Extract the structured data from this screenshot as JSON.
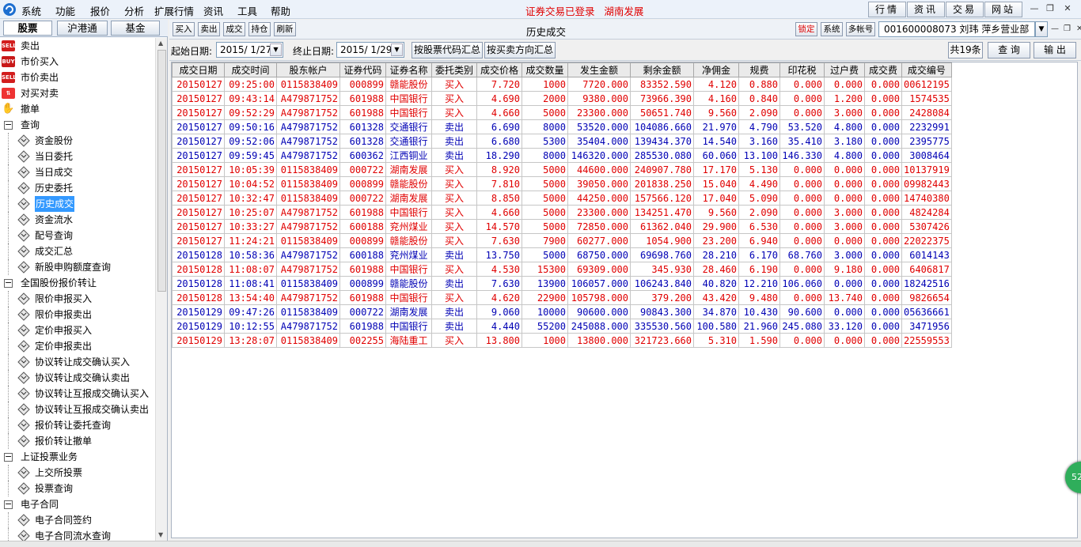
{
  "menubar": {
    "items": [
      "系统",
      "功能",
      "报价",
      "分析",
      "扩展行情",
      "资讯",
      "工具",
      "帮助"
    ],
    "status": "证券交易已登录   湖南发展",
    "right_buttons": [
      "行情",
      "资讯",
      "交易",
      "网站"
    ]
  },
  "sidebar": {
    "tabs": [
      "股票",
      "沪港通",
      "基金"
    ],
    "tree": [
      {
        "label": "卖出",
        "icon": "sell-icon",
        "icon_text": "SELL",
        "level": 0
      },
      {
        "label": "市价买入",
        "icon": "buy-icon",
        "icon_text": "BUY",
        "level": 0
      },
      {
        "label": "市价卖出",
        "icon": "sell-icon",
        "icon_text": "SELL",
        "level": 0
      },
      {
        "label": "对买对卖",
        "icon": "swap-icon",
        "icon_text": "⇅",
        "level": 0
      },
      {
        "label": "撤单",
        "icon": "cancel-icon",
        "icon_text": "✋",
        "level": 0
      },
      {
        "label": "查询",
        "icon": "collapse-icon",
        "level": 0
      },
      {
        "label": "资金股份",
        "icon": "diamond-icon",
        "level": 1
      },
      {
        "label": "当日委托",
        "icon": "diamond-icon",
        "level": 1
      },
      {
        "label": "当日成交",
        "icon": "diamond-icon",
        "level": 1
      },
      {
        "label": "历史委托",
        "icon": "diamond-icon",
        "level": 1
      },
      {
        "label": "历史成交",
        "icon": "diamond-icon",
        "level": 1,
        "selected": true
      },
      {
        "label": "资金流水",
        "icon": "diamond-icon",
        "level": 1
      },
      {
        "label": "配号查询",
        "icon": "diamond-icon",
        "level": 1
      },
      {
        "label": "成交汇总",
        "icon": "diamond-icon",
        "level": 1
      },
      {
        "label": "新股申购额度查询",
        "icon": "diamond-icon",
        "level": 1
      },
      {
        "label": "全国股份报价转让",
        "icon": "collapse-icon",
        "level": 0
      },
      {
        "label": "限价申报买入",
        "icon": "diamond-icon",
        "level": 1
      },
      {
        "label": "限价申报卖出",
        "icon": "diamond-icon",
        "level": 1
      },
      {
        "label": "定价申报买入",
        "icon": "diamond-icon",
        "level": 1
      },
      {
        "label": "定价申报卖出",
        "icon": "diamond-icon",
        "level": 1
      },
      {
        "label": "协议转让成交确认买入",
        "icon": "diamond-icon",
        "level": 1
      },
      {
        "label": "协议转让成交确认卖出",
        "icon": "diamond-icon",
        "level": 1
      },
      {
        "label": "协议转让互报成交确认买入",
        "icon": "diamond-icon",
        "level": 1
      },
      {
        "label": "协议转让互报成交确认卖出",
        "icon": "diamond-icon",
        "level": 1
      },
      {
        "label": "报价转让委托查询",
        "icon": "diamond-icon",
        "level": 1
      },
      {
        "label": "报价转让撤单",
        "icon": "diamond-icon",
        "level": 1
      },
      {
        "label": "上证投票业务",
        "icon": "collapse-icon",
        "level": 0
      },
      {
        "label": "上交所投票",
        "icon": "diamond-icon",
        "level": 1
      },
      {
        "label": "投票查询",
        "icon": "diamond-icon",
        "level": 1
      },
      {
        "label": "电子合同",
        "icon": "collapse-icon",
        "level": 0
      },
      {
        "label": "电子合同签约",
        "icon": "diamond-icon",
        "level": 1
      },
      {
        "label": "电子合同流水查询",
        "icon": "diamond-icon",
        "level": 1
      }
    ]
  },
  "toolbar": {
    "buttons": [
      "买入",
      "卖出",
      "成交",
      "持仓",
      "刷新"
    ],
    "title": "历史成交",
    "right_buttons": [
      "锁定",
      "系统",
      "多帐号"
    ],
    "account": "001600008073  刘玮  萍乡营业部"
  },
  "filter": {
    "start_label": "起始日期:",
    "start_value": "2015/ 1/27",
    "end_label": "终止日期:",
    "end_value": "2015/ 1/29",
    "btn_by_code": "按股票代码汇总",
    "btn_by_side": "按买卖方向汇总",
    "count": "共19条",
    "btn_query": "查 询",
    "btn_export": "输 出"
  },
  "table": {
    "headers": [
      "成交日期",
      "成交时间",
      "股东帐户",
      "证券代码",
      "证券名称",
      "委托类别",
      "成交价格",
      "成交数量",
      "发生金额",
      "剩余金额",
      "净佣金",
      "规费",
      "印花税",
      "过户费",
      "成交费",
      "成交编号"
    ],
    "rows": [
      {
        "side": "buy",
        "cells": [
          "20150127",
          "09:25:00",
          "0115838409",
          "000899",
          "赣能股份",
          "买入",
          "7.720",
          "1000",
          "7720.000",
          "83352.590",
          "4.120",
          "0.880",
          "0.000",
          "0.000",
          "0.000",
          "00612195"
        ]
      },
      {
        "side": "buy",
        "cells": [
          "20150127",
          "09:43:14",
          "A479871752",
          "601988",
          "中国银行",
          "买入",
          "4.690",
          "2000",
          "9380.000",
          "73966.390",
          "4.160",
          "0.840",
          "0.000",
          "1.200",
          "0.000",
          "1574535"
        ]
      },
      {
        "side": "buy",
        "cells": [
          "20150127",
          "09:52:29",
          "A479871752",
          "601988",
          "中国银行",
          "买入",
          "4.660",
          "5000",
          "23300.000",
          "50651.740",
          "9.560",
          "2.090",
          "0.000",
          "3.000",
          "0.000",
          "2428084"
        ]
      },
      {
        "side": "sell",
        "cells": [
          "20150127",
          "09:50:16",
          "A479871752",
          "601328",
          "交通银行",
          "卖出",
          "6.690",
          "8000",
          "53520.000",
          "104086.660",
          "21.970",
          "4.790",
          "53.520",
          "4.800",
          "0.000",
          "2232991"
        ]
      },
      {
        "side": "sell",
        "cells": [
          "20150127",
          "09:52:06",
          "A479871752",
          "601328",
          "交通银行",
          "卖出",
          "6.680",
          "5300",
          "35404.000",
          "139434.370",
          "14.540",
          "3.160",
          "35.410",
          "3.180",
          "0.000",
          "2395775"
        ]
      },
      {
        "side": "sell",
        "cells": [
          "20150127",
          "09:59:45",
          "A479871752",
          "600362",
          "江西铜业",
          "卖出",
          "18.290",
          "8000",
          "146320.000",
          "285530.080",
          "60.060",
          "13.100",
          "146.330",
          "4.800",
          "0.000",
          "3008464"
        ]
      },
      {
        "side": "buy",
        "cells": [
          "20150127",
          "10:05:39",
          "0115838409",
          "000722",
          "湖南发展",
          "买入",
          "8.920",
          "5000",
          "44600.000",
          "240907.780",
          "17.170",
          "5.130",
          "0.000",
          "0.000",
          "0.000",
          "10137919"
        ]
      },
      {
        "side": "buy",
        "cells": [
          "20150127",
          "10:04:52",
          "0115838409",
          "000899",
          "赣能股份",
          "买入",
          "7.810",
          "5000",
          "39050.000",
          "201838.250",
          "15.040",
          "4.490",
          "0.000",
          "0.000",
          "0.000",
          "09982443"
        ]
      },
      {
        "side": "buy",
        "cells": [
          "20150127",
          "10:32:47",
          "0115838409",
          "000722",
          "湖南发展",
          "买入",
          "8.850",
          "5000",
          "44250.000",
          "157566.120",
          "17.040",
          "5.090",
          "0.000",
          "0.000",
          "0.000",
          "14740380"
        ]
      },
      {
        "side": "buy",
        "cells": [
          "20150127",
          "10:25:07",
          "A479871752",
          "601988",
          "中国银行",
          "买入",
          "4.660",
          "5000",
          "23300.000",
          "134251.470",
          "9.560",
          "2.090",
          "0.000",
          "3.000",
          "0.000",
          "4824284"
        ]
      },
      {
        "side": "buy",
        "cells": [
          "20150127",
          "10:33:27",
          "A479871752",
          "600188",
          "兖州煤业",
          "买入",
          "14.570",
          "5000",
          "72850.000",
          "61362.040",
          "29.900",
          "6.530",
          "0.000",
          "3.000",
          "0.000",
          "5307426"
        ]
      },
      {
        "side": "buy",
        "cells": [
          "20150127",
          "11:24:21",
          "0115838409",
          "000899",
          "赣能股份",
          "买入",
          "7.630",
          "7900",
          "60277.000",
          "1054.900",
          "23.200",
          "6.940",
          "0.000",
          "0.000",
          "0.000",
          "22022375"
        ]
      },
      {
        "side": "sell",
        "cells": [
          "20150128",
          "10:58:36",
          "A479871752",
          "600188",
          "兖州煤业",
          "卖出",
          "13.750",
          "5000",
          "68750.000",
          "69698.760",
          "28.210",
          "6.170",
          "68.760",
          "3.000",
          "0.000",
          "6014143"
        ]
      },
      {
        "side": "buy",
        "cells": [
          "20150128",
          "11:08:07",
          "A479871752",
          "601988",
          "中国银行",
          "买入",
          "4.530",
          "15300",
          "69309.000",
          "345.930",
          "28.460",
          "6.190",
          "0.000",
          "9.180",
          "0.000",
          "6406817"
        ]
      },
      {
        "side": "sell",
        "cells": [
          "20150128",
          "11:08:41",
          "0115838409",
          "000899",
          "赣能股份",
          "卖出",
          "7.630",
          "13900",
          "106057.000",
          "106243.840",
          "40.820",
          "12.210",
          "106.060",
          "0.000",
          "0.000",
          "18242516"
        ]
      },
      {
        "side": "buy",
        "cells": [
          "20150128",
          "13:54:40",
          "A479871752",
          "601988",
          "中国银行",
          "买入",
          "4.620",
          "22900",
          "105798.000",
          "379.200",
          "43.420",
          "9.480",
          "0.000",
          "13.740",
          "0.000",
          "9826654"
        ]
      },
      {
        "side": "sell",
        "cells": [
          "20150129",
          "09:47:26",
          "0115838409",
          "000722",
          "湖南发展",
          "卖出",
          "9.060",
          "10000",
          "90600.000",
          "90843.300",
          "34.870",
          "10.430",
          "90.600",
          "0.000",
          "0.000",
          "05636661"
        ]
      },
      {
        "side": "sell",
        "cells": [
          "20150129",
          "10:12:55",
          "A479871752",
          "601988",
          "中国银行",
          "卖出",
          "4.440",
          "55200",
          "245088.000",
          "335530.560",
          "100.580",
          "21.960",
          "245.080",
          "33.120",
          "0.000",
          "3471956"
        ]
      },
      {
        "side": "buy",
        "cells": [
          "20150129",
          "13:28:07",
          "0115838409",
          "002255",
          "海陆重工",
          "买入",
          "13.800",
          "1000",
          "13800.000",
          "321723.660",
          "5.310",
          "1.590",
          "0.000",
          "0.000",
          "0.000",
          "22559553"
        ]
      }
    ]
  },
  "float_ball": "52",
  "colors": {
    "buy": "#e00000",
    "sell": "#0000b4",
    "status": "#e00000",
    "selected": "#3399ff"
  }
}
